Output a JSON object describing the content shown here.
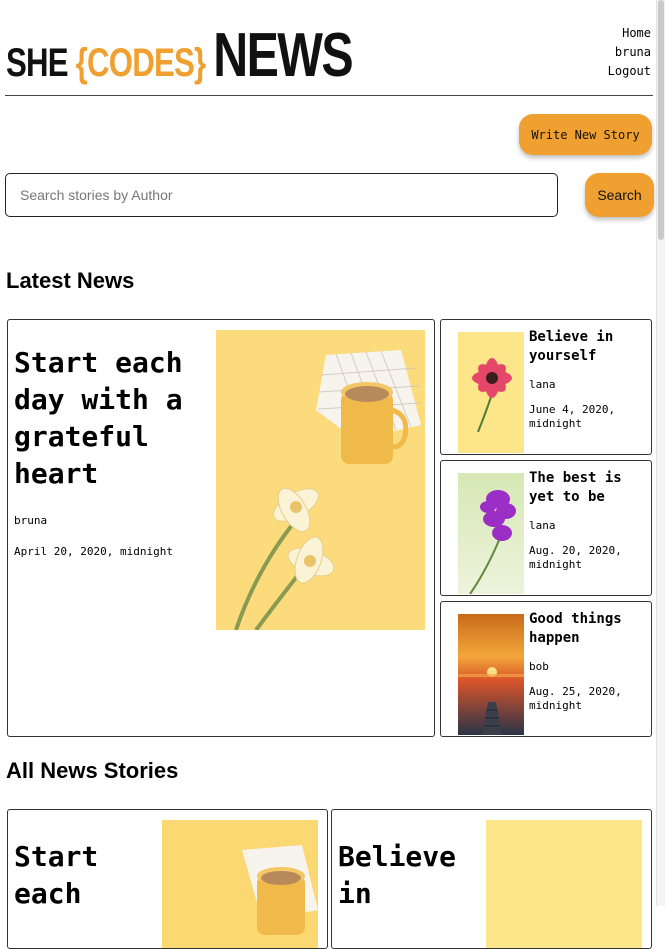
{
  "logo": {
    "she": "SHE",
    "codes": "{CODES}",
    "news": "NEWS"
  },
  "nav": {
    "home": "Home",
    "user": "bruna",
    "logout": "Logout"
  },
  "actions": {
    "write_label": "Write New Story",
    "search_label": "Search"
  },
  "search": {
    "placeholder": "Search stories by Author",
    "value": ""
  },
  "sections": {
    "latest": "Latest News",
    "all": "All News Stories"
  },
  "latest": {
    "featured": {
      "title": "Start each day with a grateful heart",
      "author": "bruna",
      "date": "April 20, 2020, midnight",
      "image": "coffee-flowers-photo"
    },
    "side": [
      {
        "title": "Believe in yourself",
        "author": "lana",
        "date": "June 4, 2020, midnight",
        "image": "pink-flower-photo"
      },
      {
        "title": "The best is yet to be",
        "author": "lana",
        "date": "Aug. 20, 2020, midnight",
        "image": "purple-orchid-photo"
      },
      {
        "title": "Good things happen",
        "author": "bob",
        "date": "Aug. 25, 2020, midnight",
        "image": "sunset-pier-photo"
      }
    ]
  },
  "all": [
    {
      "title": "Start each",
      "image": "coffee-flowers-photo"
    },
    {
      "title": "Believe in",
      "image": "pink-flower-photo"
    }
  ],
  "colors": {
    "accent": "#f0a030",
    "border": "#333333",
    "text": "#000000"
  }
}
